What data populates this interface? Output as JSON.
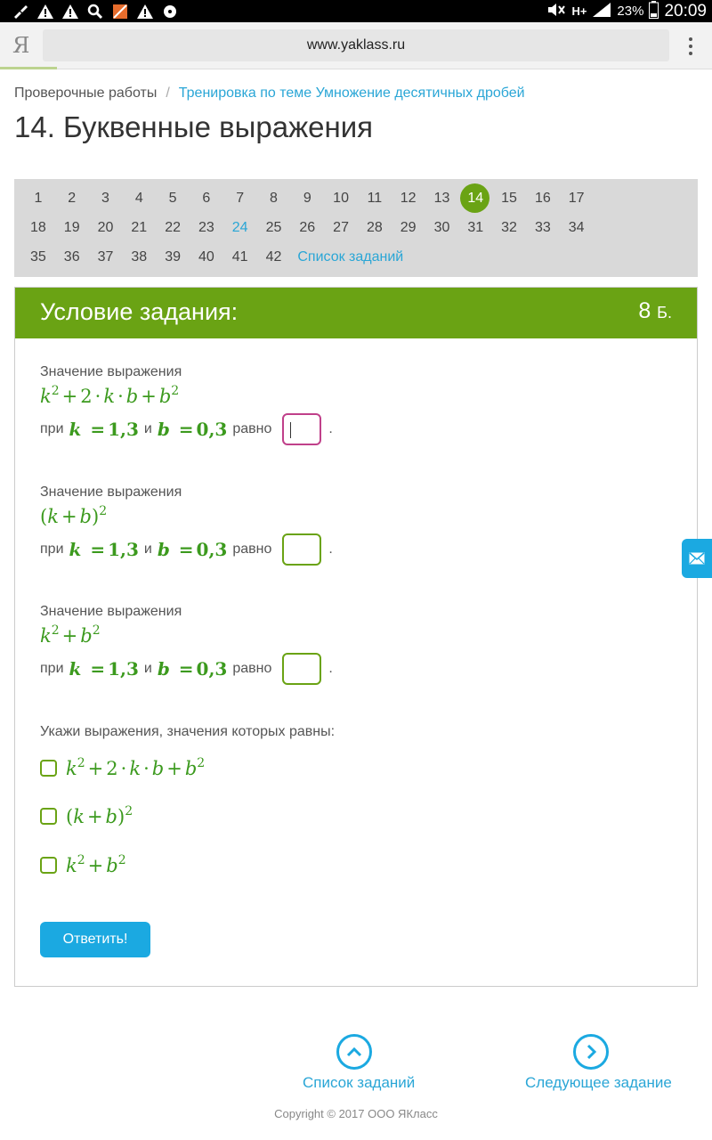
{
  "status_bar": {
    "battery": "23%",
    "time": "20:09",
    "network": "H+",
    "icons": [
      "brush-icon",
      "warning-icon",
      "warning-icon",
      "search-icon",
      "crossed-app-icon",
      "warning-icon",
      "disc-icon",
      "mute-icon",
      "signal-icon",
      "battery-icon"
    ]
  },
  "browser": {
    "logo": "Я",
    "url": "www.yaklass.ru"
  },
  "breadcrumb": {
    "root": "Проверочные работы",
    "separator": "/",
    "current": "Тренировка по теме Умножение десятичных дробей"
  },
  "page_title": "14. Буквенные выражения",
  "task_nav": {
    "rows": [
      [
        "1",
        "2",
        "3",
        "4",
        "5",
        "6",
        "7",
        "8",
        "9",
        "10",
        "11",
        "12",
        "13",
        "14",
        "15",
        "16",
        "17"
      ],
      [
        "18",
        "19",
        "20",
        "21",
        "22",
        "23",
        "24",
        "25",
        "26",
        "27",
        "28",
        "29",
        "30",
        "31",
        "32",
        "33",
        "34"
      ],
      [
        "35",
        "36",
        "37",
        "38",
        "39",
        "40",
        "41",
        "42"
      ]
    ],
    "current": "14",
    "visited": [
      "24"
    ],
    "list_link": "Список заданий"
  },
  "task": {
    "header": "Условие задания:",
    "points": "8",
    "points_unit": "Б.",
    "expression_label": "Значение выражения",
    "at_word": "при",
    "and_word": "и",
    "equals_word": "равно",
    "k_value": "1,3",
    "b_value": "0,3",
    "choose_label": "Укажи выражения, значения которых равны:",
    "submit": "Ответить!"
  },
  "footer": {
    "list_label": "Список заданий",
    "next_label": "Следующее задание",
    "copyright": "Copyright © 2017 ООО ЯКласс"
  },
  "colors": {
    "green": "#6aa314",
    "blue": "#1ba9e1",
    "active_input": "#c0408a"
  }
}
